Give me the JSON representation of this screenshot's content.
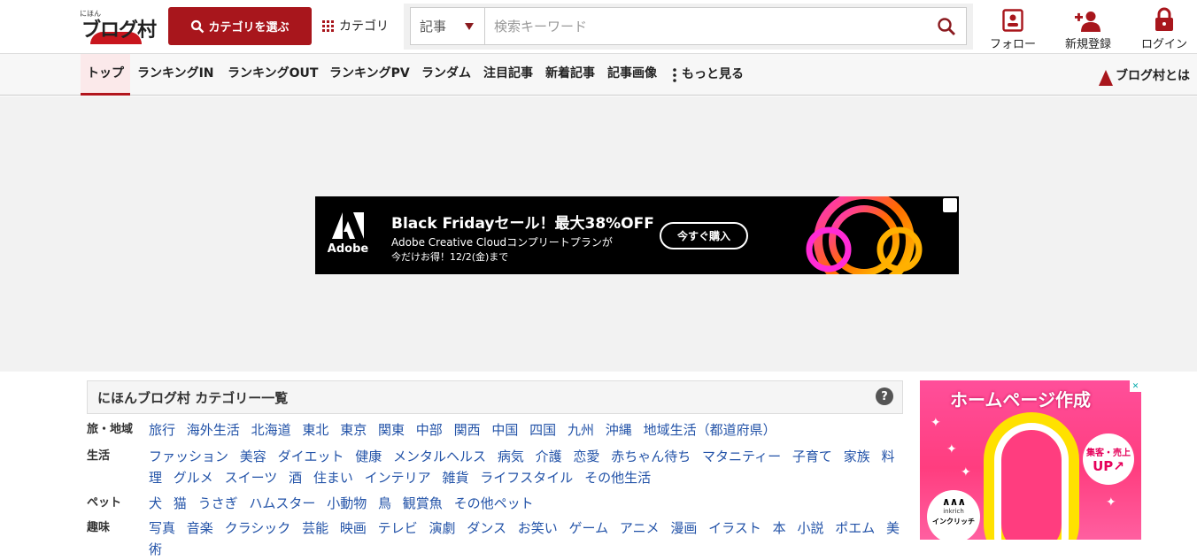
{
  "header": {
    "logo_small": "にほん",
    "logo_main": "ブログ村",
    "category_button": "カテゴリを選ぶ",
    "category_link": "カテゴリ",
    "search": {
      "type_value": "記事",
      "placeholder": "検索キーワード"
    },
    "follow_label": "フォロー",
    "signup_label": "新規登録",
    "login_label": "ログイン"
  },
  "nav": {
    "items": [
      "トップ",
      "ランキングIN",
      "ランキングOUT",
      "ランキングPV",
      "ランダム",
      "注目記事",
      "新着記事",
      "記事画像",
      "もっと見る"
    ],
    "about": "ブログ村とは"
  },
  "banner": {
    "brand": "Adobe",
    "title": "Black Fridayセール！最大38%OFF",
    "sub1": "Adobe Creative Cloudコンプリートプランが",
    "sub2": "今だけお得！12/2(金)まで",
    "buy_button": "今すぐ購入"
  },
  "categories": {
    "title": "にほんブログ村 カテゴリー一覧",
    "help": "?",
    "rows": [
      {
        "label": "旅・地域",
        "links": [
          "旅行",
          "海外生活",
          "北海道",
          "東北",
          "東京",
          "関東",
          "中部",
          "関西",
          "中国",
          "四国",
          "九州",
          "沖縄",
          "地域生活（都道府県）"
        ]
      },
      {
        "label": "生活",
        "links": [
          "ファッション",
          "美容",
          "ダイエット",
          "健康",
          "メンタルヘルス",
          "病気",
          "介護",
          "恋愛",
          "赤ちゃん待ち",
          "マタニティー",
          "子育て",
          "家族",
          "料理",
          "グルメ",
          "スイーツ",
          "酒",
          "住まい",
          "インテリア",
          "雑貨",
          "ライフスタイル",
          "その他生活"
        ]
      },
      {
        "label": "ペット",
        "links": [
          "犬",
          "猫",
          "うさぎ",
          "ハムスター",
          "小動物",
          "鳥",
          "観賞魚",
          "その他ペット"
        ]
      },
      {
        "label": "趣味",
        "links": [
          "写真",
          "音楽",
          "クラシック",
          "芸能",
          "映画",
          "テレビ",
          "演劇",
          "ダンス",
          "お笑い",
          "ゲーム",
          "アニメ",
          "漫画",
          "イラスト",
          "本",
          "小説",
          "ポエム",
          "美術"
        ]
      }
    ]
  },
  "side_ad": {
    "title": "ホームページ作成",
    "badge_line1": "集客・売上",
    "badge_line2": "UP↗",
    "logo_mark": "∧∧∧",
    "logo_en": "inkrich",
    "logo_jp": "インクリッチ"
  },
  "colors": {
    "brand_red": "#a8161c",
    "link_blue": "#2353a8",
    "ad_pink": "#ff3d7f"
  }
}
